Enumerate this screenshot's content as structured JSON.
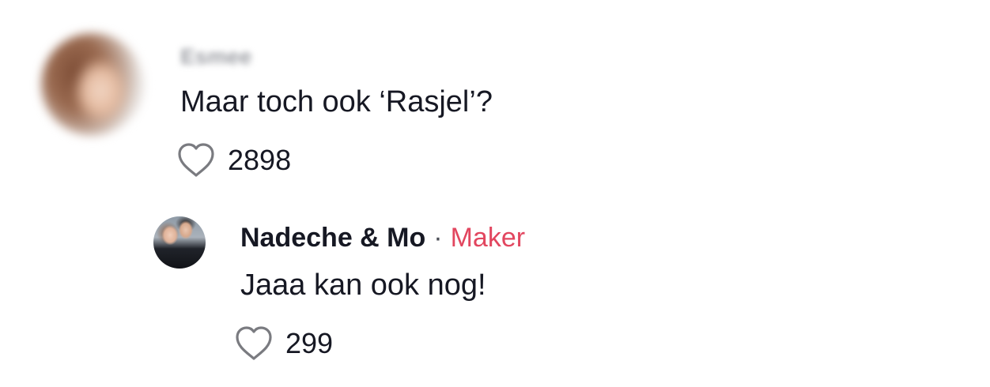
{
  "comment": {
    "username": "Esmee",
    "text": "Maar toch ook ‘Rasjel’?",
    "likes": "2898",
    "like_icon": "heart-outline-icon"
  },
  "reply": {
    "username": "Nadeche & Mo",
    "separator": "·",
    "creator_label": "Maker",
    "text": "Jaaa kan ook nog!",
    "likes": "299",
    "like_icon": "heart-outline-icon"
  },
  "colors": {
    "text": "#161823",
    "creator_label": "#e2465f",
    "icon_stroke": "#7a7b80"
  }
}
